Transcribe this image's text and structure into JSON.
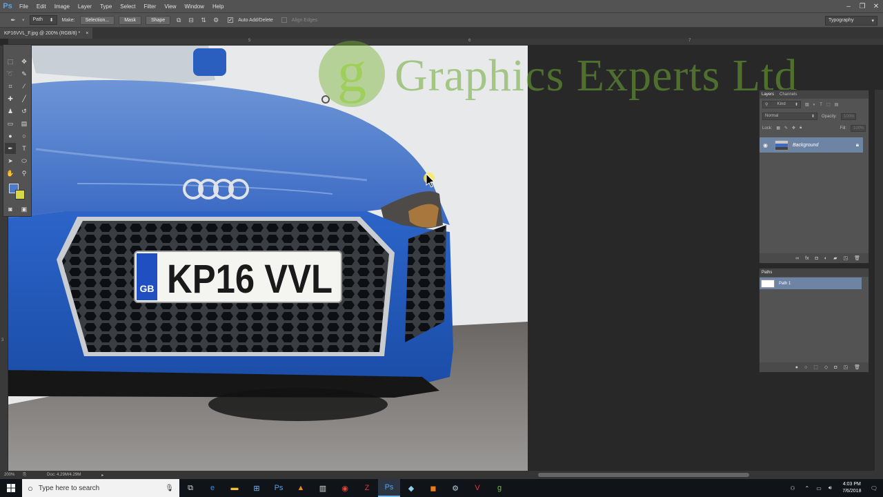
{
  "menubar": {
    "app_icon": "Ps",
    "items": [
      "File",
      "Edit",
      "Image",
      "Layer",
      "Type",
      "Select",
      "Filter",
      "View",
      "Window",
      "Help"
    ],
    "window_controls": [
      "–",
      "❐",
      "✕"
    ]
  },
  "options": {
    "tool_mode": "Path",
    "make_label": "Make:",
    "selection_btn": "Selection...",
    "mask_btn": "Mask",
    "shape_btn": "Shape",
    "auto_add_delete": "Auto Add/Delete",
    "align_edges": "Align Edges",
    "workspace": "Typography"
  },
  "document": {
    "tab_title": "KP16VVL_F.jpg @ 200% (RGB/8) *",
    "zoom": "200%",
    "doc_size": "Doc: 4.29M/4.29M"
  },
  "rulers": {
    "top_marks": [
      "5",
      "6",
      "7"
    ],
    "left_marks": [
      "3"
    ]
  },
  "canvas": {
    "plate_text": "KP16 VVL",
    "plate_country": "GB",
    "watermark_text": "Graphics Experts Ltd",
    "watermark_logo_letter": "g"
  },
  "layers_panel": {
    "tabs": [
      "Layers",
      "Channels"
    ],
    "kind_label": "Kind",
    "blend_mode": "Normal",
    "opacity_label": "Opacity:",
    "opacity_value": "100%",
    "lock_label": "Lock:",
    "fill_label": "Fill:",
    "fill_value": "100%",
    "layer_name": "Background"
  },
  "paths_panel": {
    "tab": "Paths",
    "path_name": "Path 1"
  },
  "taskbar": {
    "search_placeholder": "Type here to search",
    "time": "4:03 PM",
    "date": "7/6/2018"
  },
  "colors": {
    "foreground": "#4a7ac9",
    "background": "#d6d844",
    "car_blue": "#2e62c4"
  }
}
